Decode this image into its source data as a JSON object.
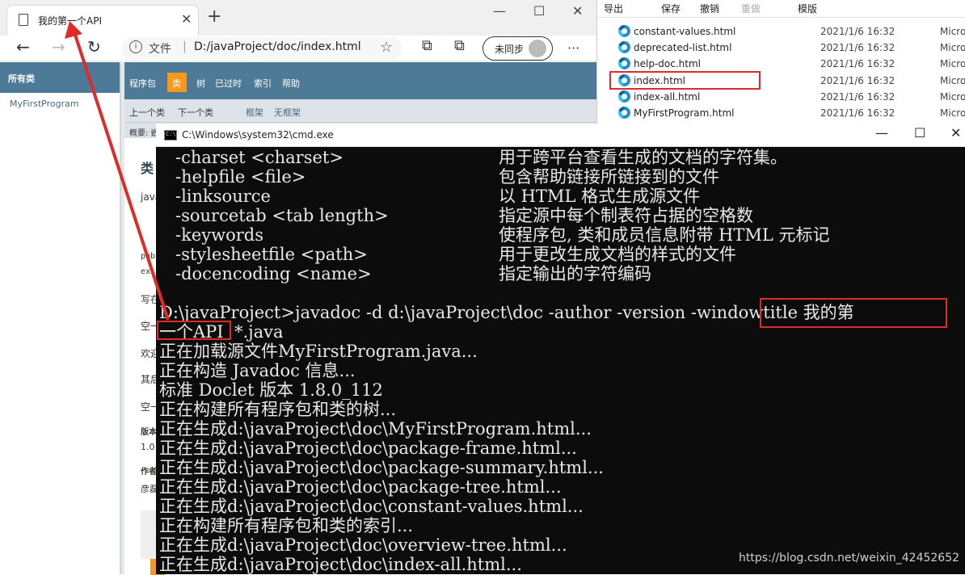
{
  "browser": {
    "tab_title": "我的第一个API",
    "tab_close": "✕",
    "new_tab": "+",
    "win_min": "—",
    "win_max": "☐",
    "win_close": "✕",
    "nav_back": "←",
    "nav_forward": "→",
    "nav_refresh": "↻",
    "address_label": "文件",
    "address_sep": "|",
    "address_url": "D:/javaProject/doc/index.html",
    "star": "☆",
    "collections": "⧉",
    "sync_label": "未同步",
    "more": "···"
  },
  "javadoc": {
    "left_header": "所有类",
    "left_link": "MyFirstProgram",
    "nav_items": [
      "程序包",
      "类",
      "树",
      "已过时",
      "索引",
      "帮助"
    ],
    "sub_nav": [
      "上一个类",
      "下一个类"
    ],
    "sub_links": [
      "框架",
      "无框架"
    ],
    "summary": "概要: 嵌",
    "stub_title": "类",
    "stub_lines": [
      "java",
      "pub",
      "ext",
      "写在",
      "空一",
      "欢迎",
      "其后",
      "空一",
      "版本",
      "1.0",
      "作者",
      "彦磊"
    ]
  },
  "explorer": {
    "toolbar": [
      "导出",
      "保存",
      "撤销",
      "重做",
      "模版"
    ],
    "files": [
      {
        "name": "constant-values.html",
        "date": "2021/1/6 16:32",
        "type": "Micros"
      },
      {
        "name": "deprecated-list.html",
        "date": "2021/1/6 16:32",
        "type": "Micros"
      },
      {
        "name": "help-doc.html",
        "date": "2021/1/6 16:32",
        "type": "Micros"
      },
      {
        "name": "index.html",
        "date": "2021/1/6 16:32",
        "type": "Micros"
      },
      {
        "name": "index-all.html",
        "date": "2021/1/6 16:32",
        "type": "Micros"
      },
      {
        "name": "MyFirstProgram.html",
        "date": "2021/1/6 16:32",
        "type": "Micros"
      }
    ]
  },
  "cmd": {
    "title": "C:\\Windows\\system32\\cmd.exe",
    "icon_text": "C:\\",
    "win_min": "—",
    "win_max": "☐",
    "win_close": "✕",
    "options": [
      {
        "flag": "-charset <charset>",
        "desc": "用于跨平台查看生成的文档的字符集。"
      },
      {
        "flag": "-helpfile <file>",
        "desc": "包含帮助链接所链接到的文件"
      },
      {
        "flag": "-linksource",
        "desc": "以 HTML 格式生成源文件"
      },
      {
        "flag": "-sourcetab <tab length>",
        "desc": "指定源中每个制表符占据的空格数"
      },
      {
        "flag": "-keywords",
        "desc": "使程序包, 类和成员信息附带 HTML 元标记"
      },
      {
        "flag": "-stylesheetfile <path>",
        "desc": "用于更改生成文档的样式的文件"
      },
      {
        "flag": "-docencoding <name>",
        "desc": "指定输出的字符编码"
      }
    ],
    "output": [
      "D:\\javaProject>javadoc -d d:\\javaProject\\doc -author -version -windowtitle 我的第",
      "一个API  *.java",
      "正在加载源文件MyFirstProgram.java...",
      "正在构造 Javadoc 信息...",
      "标准 Doclet 版本 1.8.0_112",
      "正在构建所有程序包和类的树...",
      "正在生成d:\\javaProject\\doc\\MyFirstProgram.html...",
      "正在生成d:\\javaProject\\doc\\package-frame.html...",
      "正在生成d:\\javaProject\\doc\\package-summary.html...",
      "正在生成d:\\javaProject\\doc\\package-tree.html...",
      "正在生成d:\\javaProject\\doc\\constant-values.html...",
      "正在构建所有程序包和类的索引...",
      "正在生成d:\\javaProject\\doc\\overview-tree.html...",
      "正在生成d:\\javaProject\\doc\\index-all.html..."
    ]
  },
  "watermark": "https://blog.csdn.net/weixin_42452652",
  "colors": {
    "javadoc_nav": "#4d7a97",
    "javadoc_active": "#f8981d",
    "highlight": "#e02b2b",
    "arrow": "#e02b2b"
  }
}
